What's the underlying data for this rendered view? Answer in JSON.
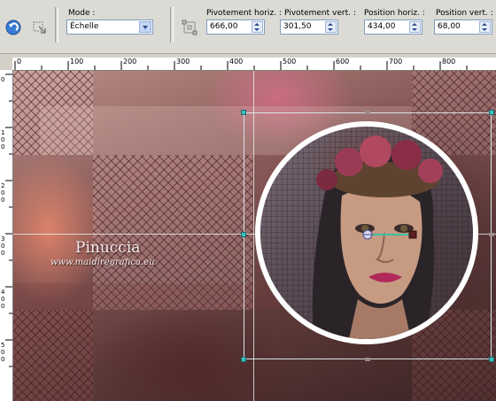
{
  "toolbar": {
    "mode_label": "Mode :",
    "mode_value": "Échelle",
    "fields": [
      {
        "label": "Pivotement horiz. :",
        "value": "666,00"
      },
      {
        "label": "Pivotement vert. :",
        "value": "301,50"
      },
      {
        "label": "Position horiz. :",
        "value": "434,00"
      },
      {
        "label": "Position vert. :",
        "value": "68,00"
      }
    ],
    "icons": [
      "undo-icon",
      "pick-tool-icon",
      "reset-transform-icon"
    ]
  },
  "ruler": {
    "h_labels": [
      "0",
      "100",
      "200",
      "300",
      "400",
      "500",
      "600",
      "700",
      "800"
    ],
    "v_labels": [
      "0",
      "1\n0\n0",
      "2\n0\n0",
      "3\n0\n0",
      "4\n0\n0",
      "5\n0\n0"
    ]
  },
  "canvas": {
    "watermark_name": "Pinuccia",
    "watermark_url": "www.maidiregrafica.eu"
  },
  "colors": {
    "handle": "#3cc0c0",
    "toolbar_bg": "#dcdad5",
    "field_border": "#7f9db9"
  }
}
